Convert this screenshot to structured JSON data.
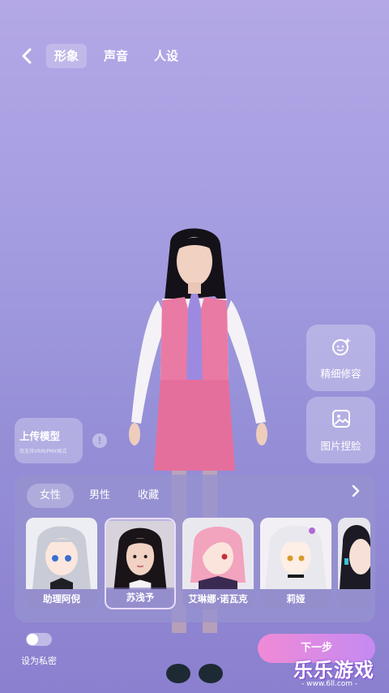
{
  "nav": {
    "tabs": [
      "形象",
      "声音",
      "人设"
    ],
    "active_tab": 0
  },
  "side_buttons": {
    "fine_edit": "精细修容",
    "photo_sculpt": "图片捏脸"
  },
  "upload": {
    "title": "上传模型",
    "subtitle": "仅支持VRM/PMX格式",
    "info_symbol": "!"
  },
  "panel": {
    "categories": [
      "女性",
      "男性",
      "收藏"
    ],
    "active_category": 0,
    "characters": [
      {
        "name": "助理阿倪",
        "hair": "#c9ccd6"
      },
      {
        "name": "苏浅予",
        "hair": "#1a1418"
      },
      {
        "name": "艾琳娜·诺瓦克",
        "hair": "#f2a3bd"
      },
      {
        "name": "莉娅",
        "hair": "#e8e8ee"
      },
      {
        "name": "",
        "hair": "#1c1a24"
      }
    ],
    "selected_character": 1
  },
  "privacy": {
    "label": "设为私密",
    "enabled": false
  },
  "next_button": "下一步",
  "watermark": {
    "title": "乐乐游戏",
    "url": "- www.6ll.com -"
  },
  "colors": {
    "accent_gradient_start": "#f08ad6",
    "accent_gradient_end": "#c58af2",
    "outfit_pink": "#e97aa4",
    "tie_purple": "#9c8ae0"
  }
}
